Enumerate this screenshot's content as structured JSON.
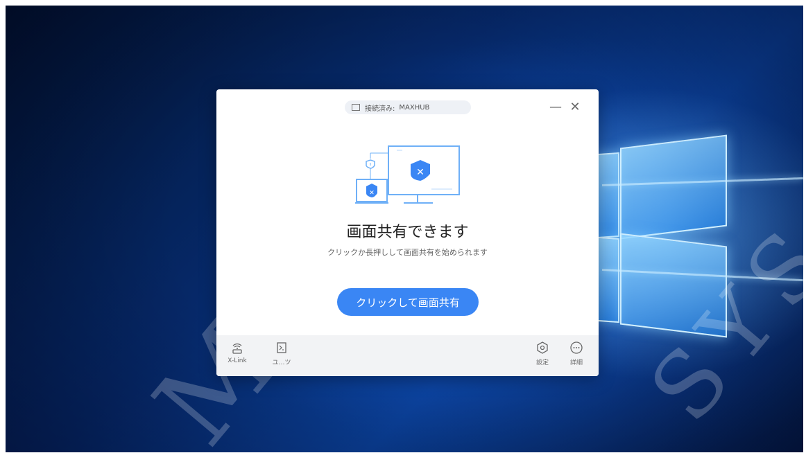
{
  "window": {
    "status_prefix": "接続済み:",
    "status_device": "MAXHUB",
    "minimize_symbol": "—",
    "close_symbol": "✕"
  },
  "main": {
    "heading": "画面共有できます",
    "subtext": "クリックか長押しして画面共有を始められます",
    "share_button": "クリックして画面共有"
  },
  "bottom_bar": {
    "xlink_label": "X-Link",
    "tools_label": "ユ…ツ",
    "settings_label": "設定",
    "details_label": "詳細"
  },
  "watermark": {
    "text_left": "MAYA",
    "text_right": "SYS"
  },
  "colors": {
    "accent": "#3a86f4",
    "illustration_blue": "#6fb0f7"
  }
}
